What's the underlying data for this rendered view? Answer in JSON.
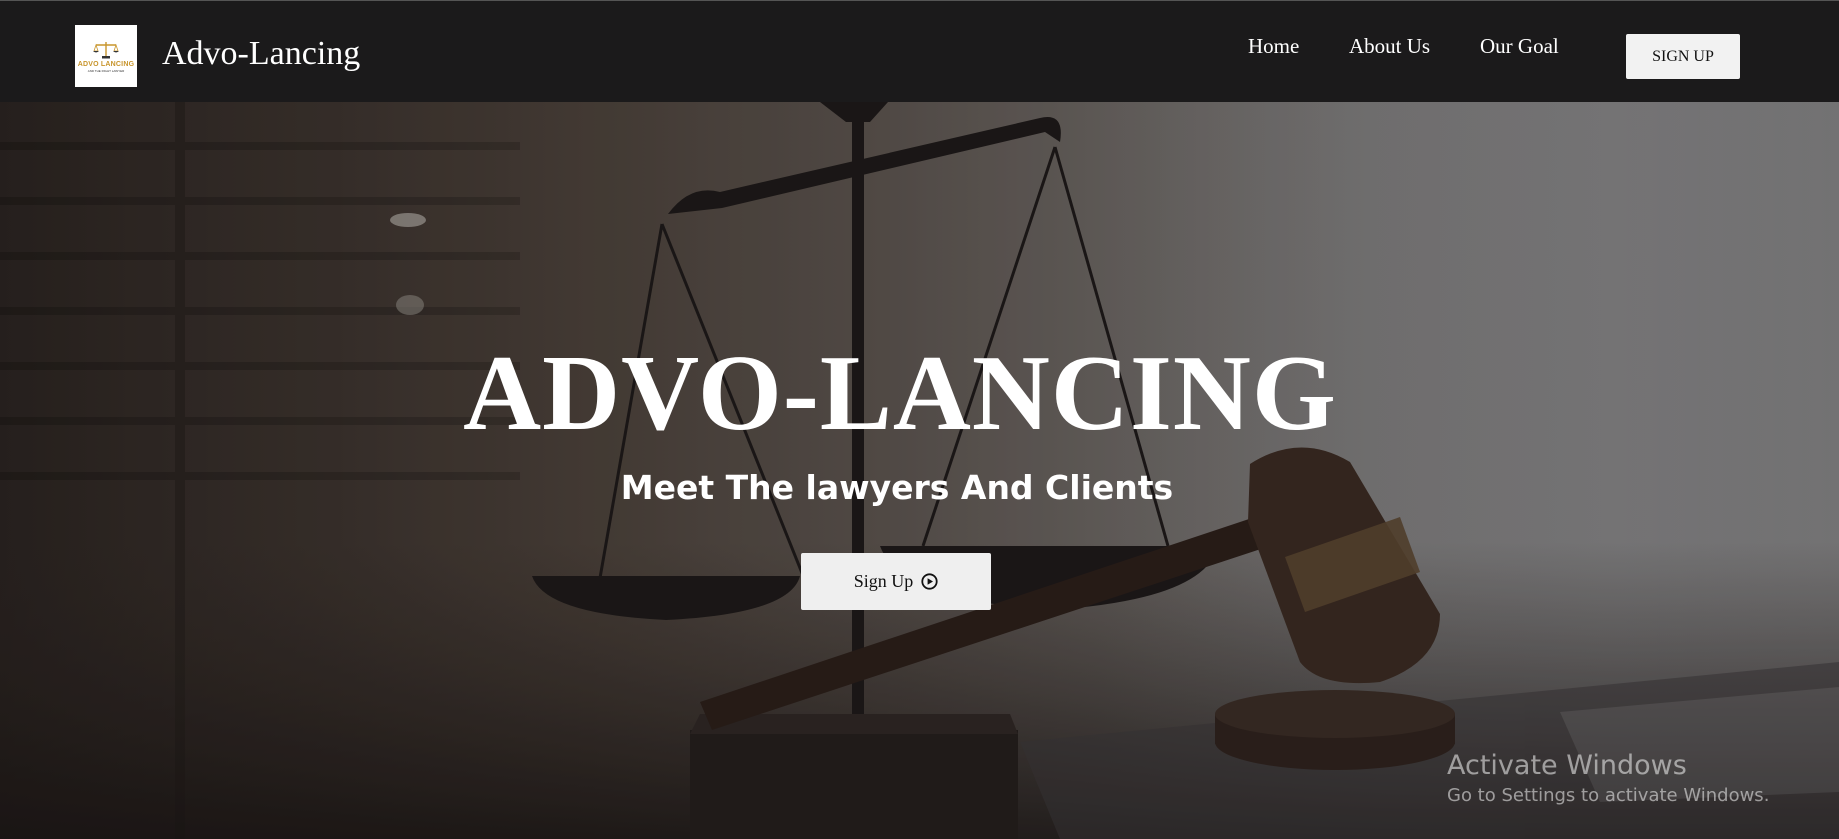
{
  "header": {
    "logo": {
      "icon": "scales-icon",
      "text": "ADVO LANCING",
      "subtext": "AND THE RIGHT LAWYER"
    },
    "brand": "Advo-Lancing",
    "nav": [
      "Home",
      "About Us",
      "Our Goal"
    ],
    "signup_label": "SIGN UP"
  },
  "hero": {
    "title": "ADVO-LANCING",
    "subtitle": "Meet The lawyers And Clients",
    "button_label": "Sign Up",
    "button_icon": "play-circle-icon",
    "background_image": "scales-of-justice-and-gavel"
  },
  "watermark": {
    "title": "Activate Windows",
    "subtitle": "Go to Settings to activate Windows."
  },
  "colors": {
    "header_bg": "#1b1a1b",
    "text": "#ffffff",
    "button_bg": "#efefef",
    "logo_gold": "#c8952c"
  }
}
